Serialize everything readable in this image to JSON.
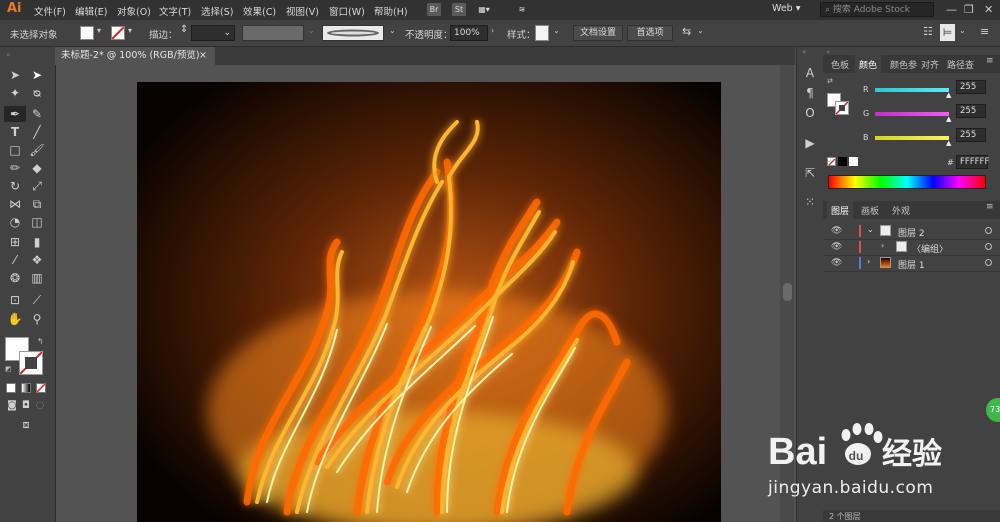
{
  "app": {
    "logo": "Ai"
  },
  "menubar": {
    "items": [
      "文件(F)",
      "编辑(E)",
      "对象(O)",
      "文字(T)",
      "选择(S)",
      "效果(C)",
      "视图(V)",
      "窗口(W)",
      "帮助(H)"
    ],
    "bridge": "Br",
    "stock": "St",
    "workspace": "Web",
    "search_placeholder": "搜索 Adobe Stock",
    "window_buttons": [
      "—",
      "❐",
      "✕"
    ]
  },
  "control_bar": {
    "selection": "未选择对象",
    "stroke_label": "描边：",
    "opacity_label": "不透明度：",
    "opacity_value": "100%",
    "style_label": "样式：",
    "doc_setup": "文档设置",
    "preferences": "首选项"
  },
  "document": {
    "tab_title": "未标题-2* @ 100% (RGB/预览)",
    "close": "×"
  },
  "color_panel": {
    "tabs": [
      "色板",
      "颜色",
      "颜色参",
      "对齐",
      "路径查"
    ],
    "active_tab": "颜色",
    "channels": [
      {
        "label": "R",
        "value": "255",
        "color": "#4fd4e0"
      },
      {
        "label": "G",
        "value": "255",
        "color": "#d13fd8"
      },
      {
        "label": "B",
        "value": "255",
        "color": "#e7e53a"
      }
    ],
    "hex_label": "#",
    "hex_value": "FFFFFF"
  },
  "layers_panel": {
    "tabs": [
      "图层",
      "画板",
      "外观"
    ],
    "active_tab": "图层",
    "rows": [
      {
        "name": "图层 2",
        "color": "#e04f4f",
        "indent": 0,
        "expanded": true
      },
      {
        "name": "〈编组〉",
        "color": "#e04f4f",
        "indent": 1,
        "expanded": false
      },
      {
        "name": "图层 1",
        "color": "#4f7fe0",
        "indent": 0,
        "expanded": false
      }
    ],
    "footer": "2 个图层"
  },
  "watermark": {
    "brand": "Bai",
    "brand_suffix": "经验",
    "url": "jingyan.baidu.com",
    "badge": "73"
  }
}
